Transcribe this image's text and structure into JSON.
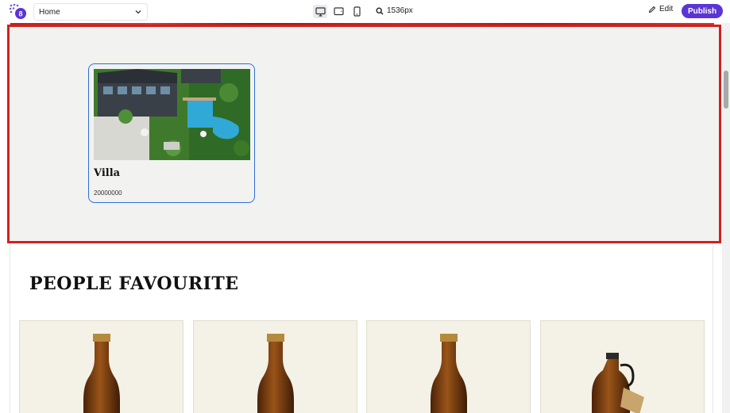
{
  "toolbar": {
    "page_select": {
      "value": "Home"
    },
    "devices": [
      {
        "name": "desktop",
        "active": true
      },
      {
        "name": "tablet",
        "active": false
      },
      {
        "name": "mobile",
        "active": false
      }
    ],
    "zoom_label": "1536px",
    "edit_label": "Edit",
    "publish_label": "Publish"
  },
  "featured": {
    "card": {
      "title": "Villa",
      "price": "20000000"
    }
  },
  "people_favourite": {
    "title": "PEOPLE FAVOURITE",
    "products": [
      {
        "kind": "beer-bottle"
      },
      {
        "kind": "beer-bottle"
      },
      {
        "kind": "beer-bottle"
      },
      {
        "kind": "growler"
      }
    ]
  },
  "colors": {
    "accent": "#5b34d6",
    "selection_outline": "#d2201f",
    "card_outline": "#2f6fd6",
    "product_bg": "#f4f1e6"
  }
}
